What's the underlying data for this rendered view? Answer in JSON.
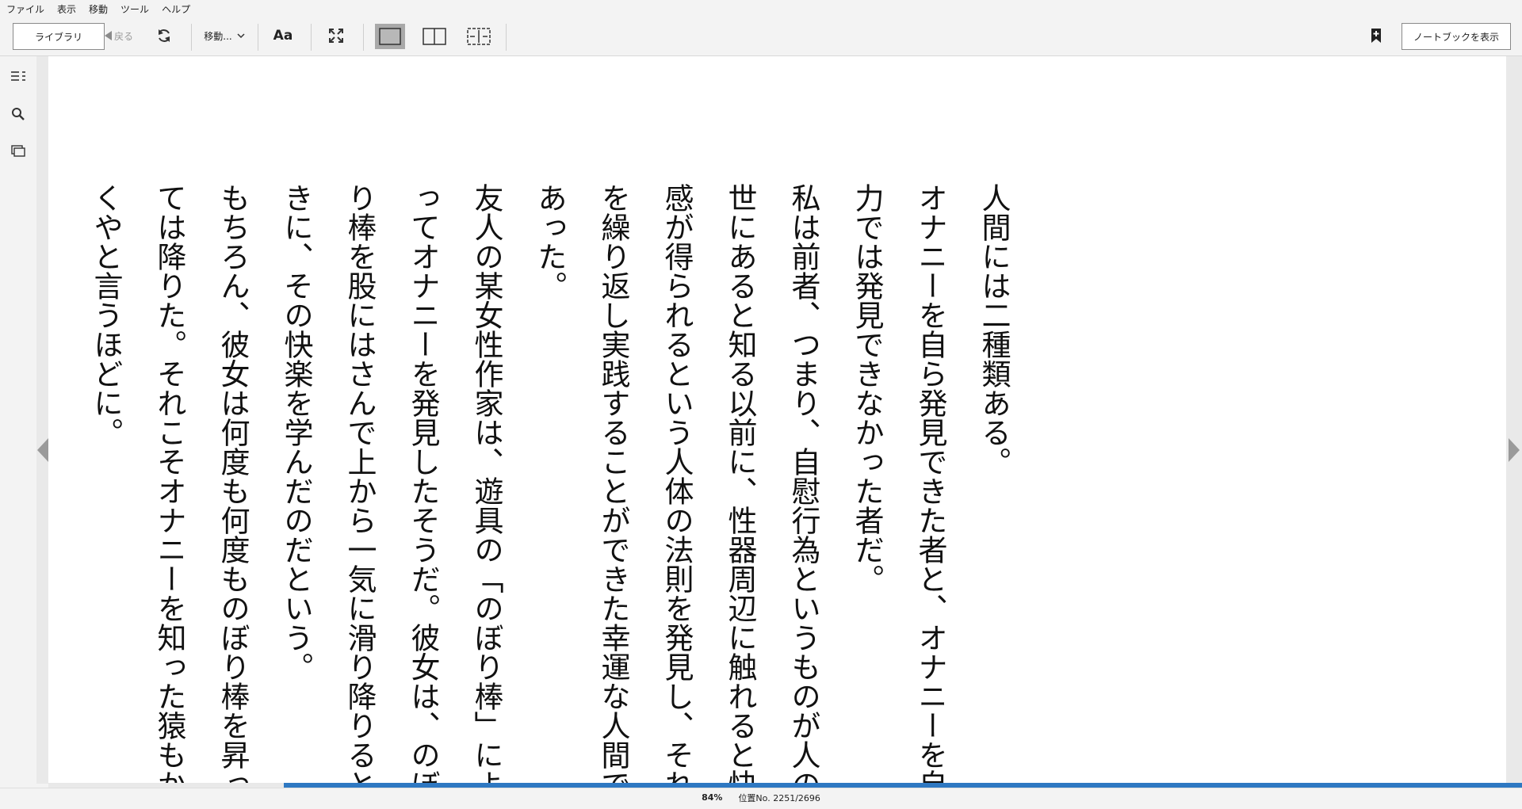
{
  "menu": [
    "ファイル",
    "表示",
    "移動",
    "ツール",
    "ヘルプ"
  ],
  "toolbar": {
    "library_label": "ライブラリ",
    "back_label": "戻る",
    "goto_label": "移動...",
    "font_label": "Aa",
    "notebook_label": "ノートブックを表示"
  },
  "content": {
    "paragraphs": [
      "人間には二種類ある。",
      "オナニーを自ら発見できた者と、オナニーを自力では発見できなかった者だ。",
      "私は前者、つまり、自慰行為というものが人の世にあると知る以前に、性器周辺に触れると快感が得られるという人体の法則を発見し、それを繰り返し実践することができた幸運な人間であった。",
      "友人の某女性作家は、遊具の「のぼり棒」によってオナニーを発見したそうだ。彼女は、のぼり棒を股にはさんで上から一気に滑り降りるときに、その快楽を学んだのだという。",
      "もちろん、彼女は何度も何度ものぼり棒を昇っては降りた。それこそオナニーを知った猿もかくやと言うほどに。"
    ]
  },
  "status": {
    "percent": "84%",
    "location": "位置No. 2251/2696",
    "progress_fraction": 0.84
  },
  "colors": {
    "accent": "#2e78c2",
    "active_view": "#a9a9a9"
  },
  "icons": [
    "toc-icon",
    "search-icon",
    "flashcards-icon",
    "refresh-icon",
    "chevron-down-icon",
    "fullscreen-icon",
    "single-page-icon",
    "two-page-icon",
    "fit-width-icon",
    "bookmark-add-icon",
    "prev-page-icon",
    "next-page-icon",
    "back-arrow-icon"
  ]
}
